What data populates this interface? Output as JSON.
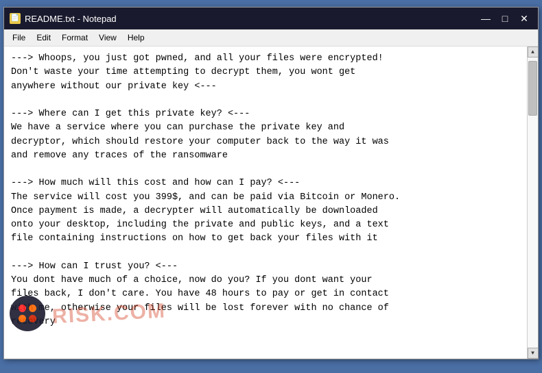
{
  "window": {
    "title": "README.txt - Notepad",
    "icon_char": "📄"
  },
  "titlebar": {
    "minimize_label": "—",
    "maximize_label": "□",
    "close_label": "✕"
  },
  "menu": {
    "items": [
      "File",
      "Edit",
      "Format",
      "View",
      "Help"
    ]
  },
  "content": {
    "text": "---> Whoops, you just got pwned, and all your files were encrypted!\nDon't waste your time attempting to decrypt them, you wont get\nanywhere without our private key <---\n\n---> Where can I get this private key? <---\nWe have a service where you can purchase the private key and\ndecryptor, which should restore your computer back to the way it was\nand remove any traces of the ransomware\n\n---> How much will this cost and how can I pay? <---\nThe service will cost you 399$, and can be paid via Bitcoin or Monero.\nOnce payment is made, a decrypter will automatically be downloaded\nonto your desktop, including the private and public keys, and a text\nfile containing instructions on how to get back your files with it\n\n---> How can I trust you? <---\nYou dont have much of a choice, now do you? If you dont want your\nfiles back, I don't care. You have 48 hours to pay or get in contact\nwith me, otherwise your files will be lost forever with no chance of\nrecovery"
  },
  "watermark": {
    "text": "RISK.COM"
  }
}
